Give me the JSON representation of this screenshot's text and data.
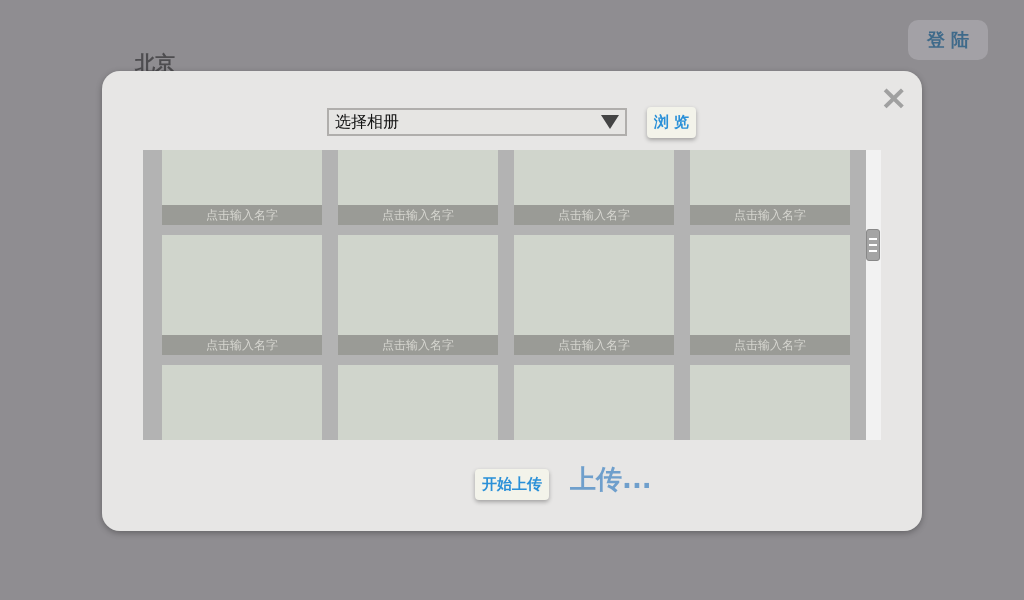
{
  "page": {
    "city": "北京",
    "login_button": "登 陆",
    "upload_status": "上传..."
  },
  "dialog": {
    "close": "×",
    "album_select": {
      "value": "选择相册"
    },
    "browse_button": "浏 览",
    "tiles": [
      {
        "label": "点击输入名字"
      },
      {
        "label": "点击输入名字"
      },
      {
        "label": "点击输入名字"
      },
      {
        "label": "点击输入名字"
      },
      {
        "label": "点击输入名字"
      },
      {
        "label": "点击输入名字"
      },
      {
        "label": "点击输入名字"
      },
      {
        "label": "点击输入名字"
      },
      {
        "kind": "blank"
      },
      {
        "kind": "blank"
      },
      {
        "kind": "blank"
      },
      {
        "kind": "blank"
      }
    ],
    "upload_button": "开始上传"
  }
}
